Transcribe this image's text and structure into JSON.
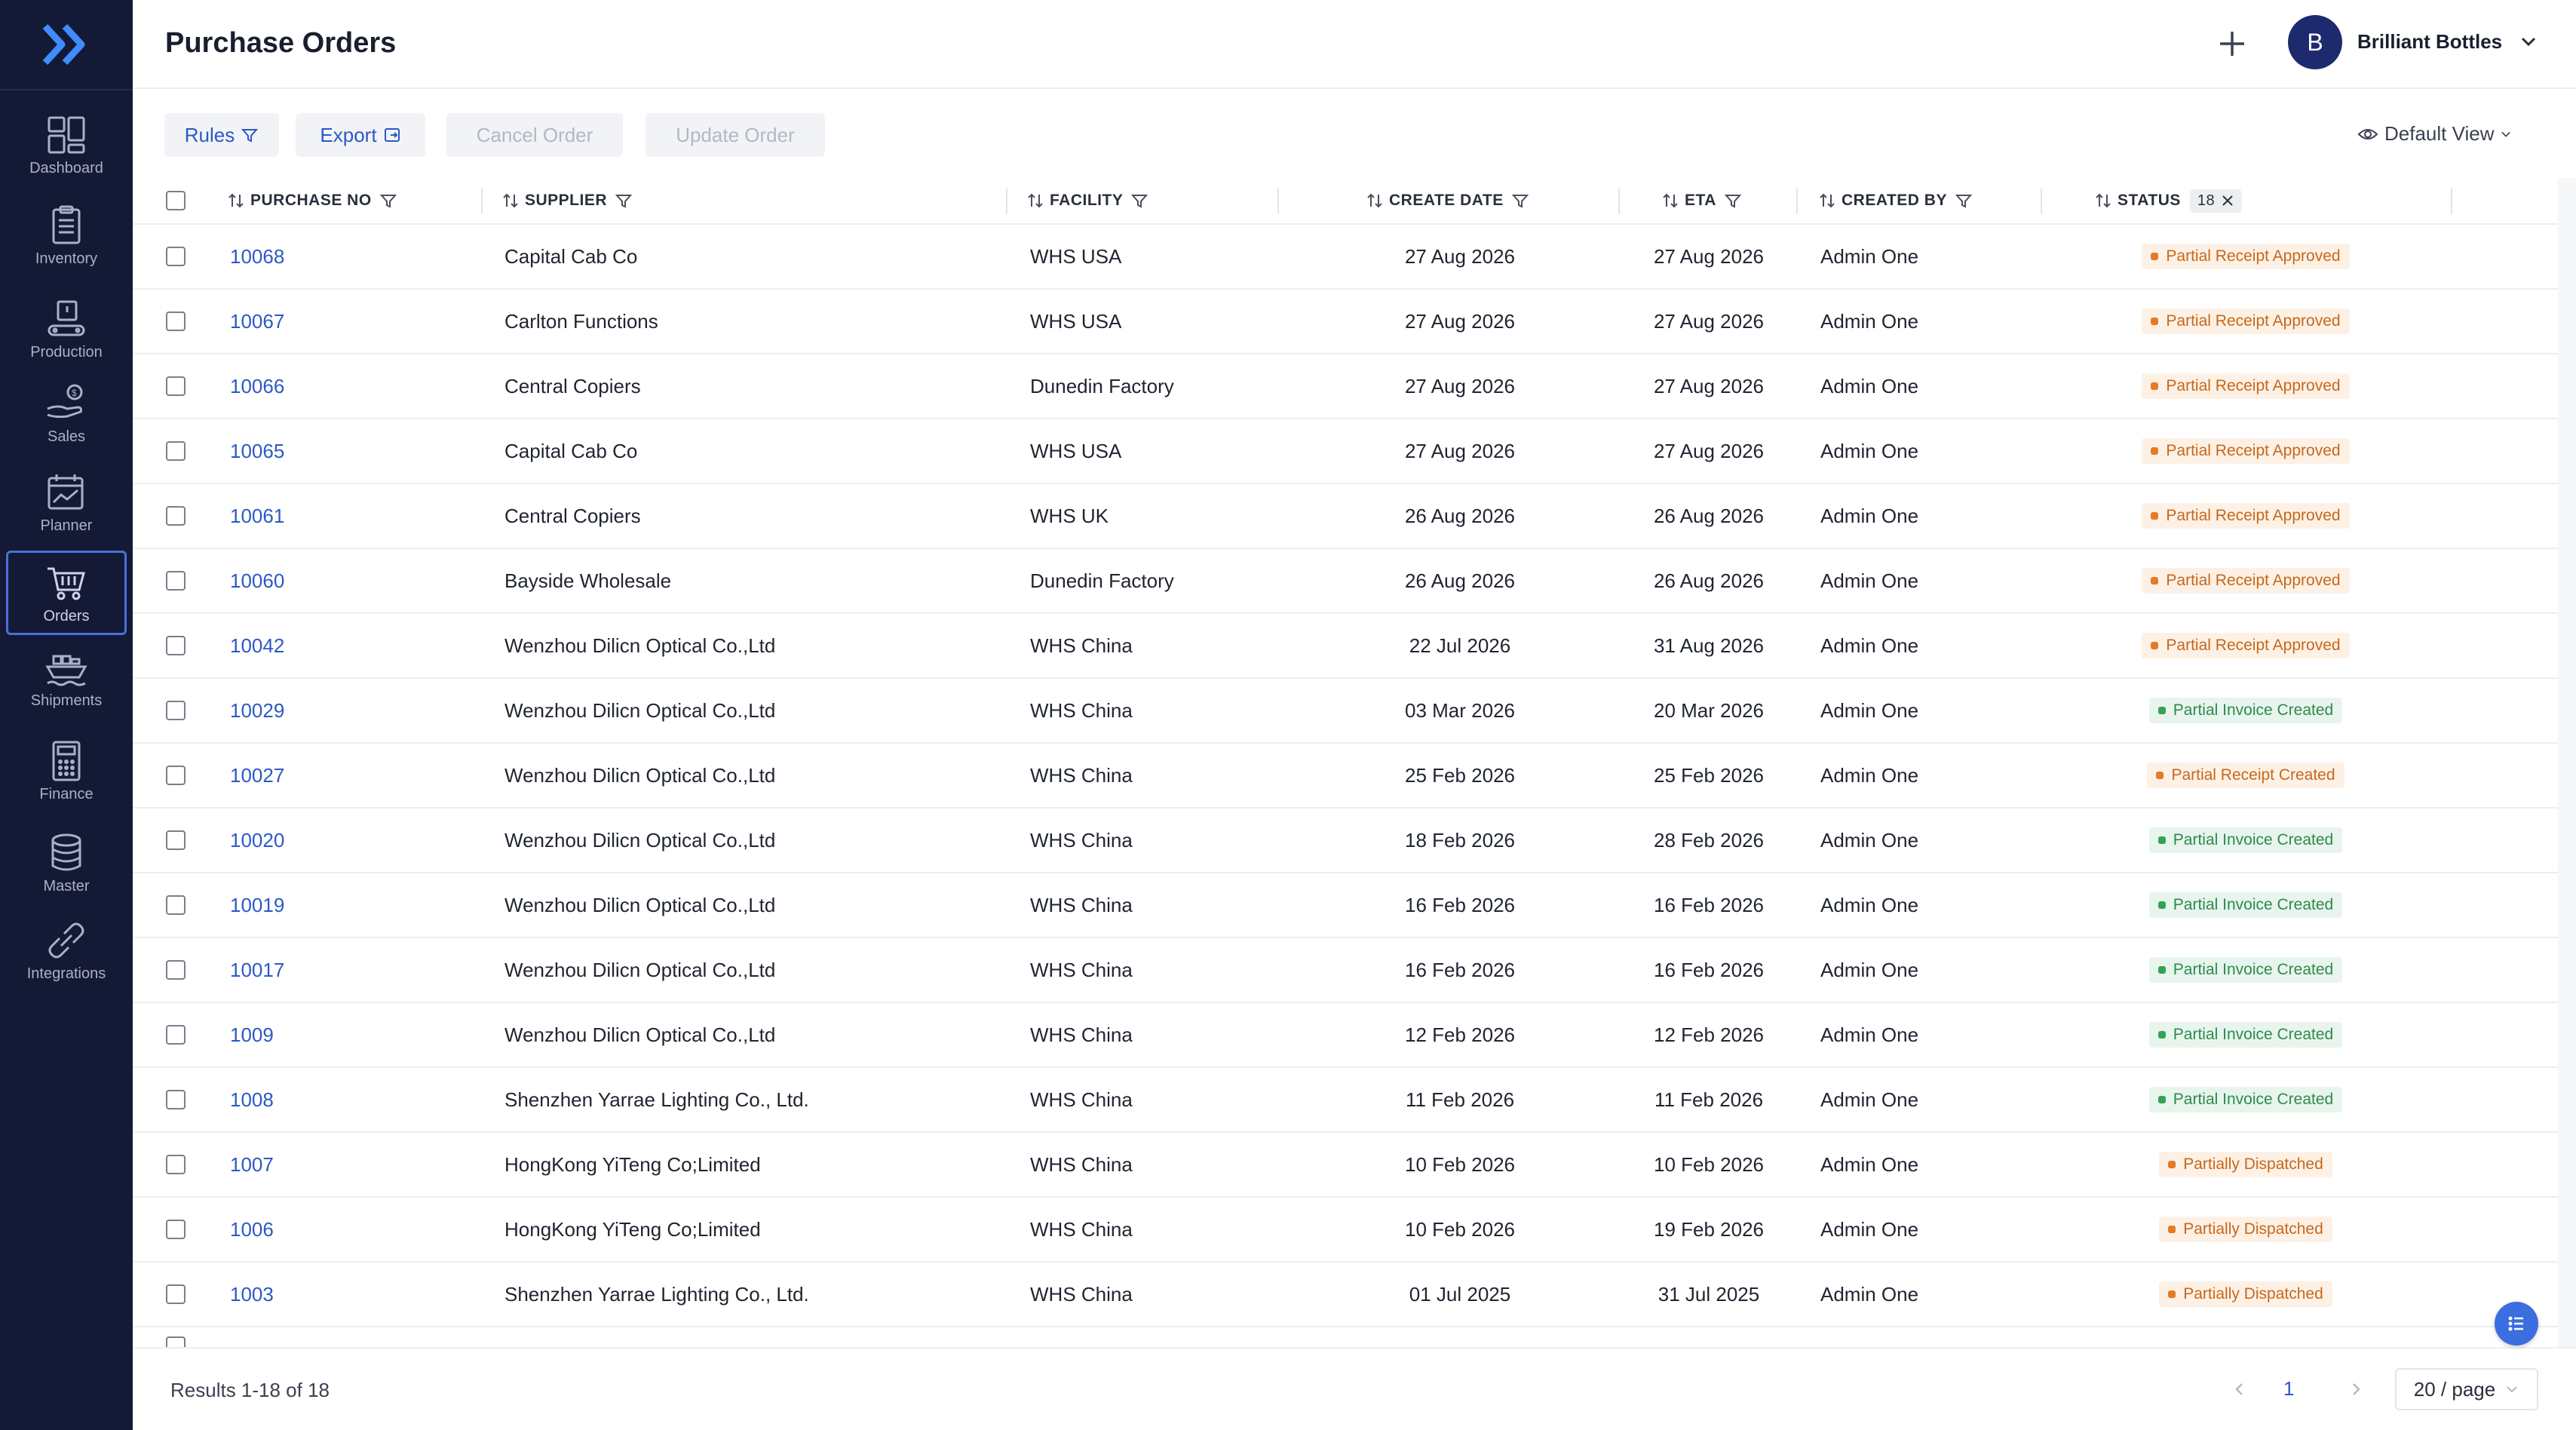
{
  "sidebar": {
    "items": [
      {
        "label": "Dashboard",
        "icon": "dashboard-icon"
      },
      {
        "label": "Inventory",
        "icon": "clipboard-icon"
      },
      {
        "label": "Production",
        "icon": "conveyor-icon"
      },
      {
        "label": "Sales",
        "icon": "sales-hand-icon"
      },
      {
        "label": "Planner",
        "icon": "calendar-chart-icon"
      },
      {
        "label": "Orders",
        "icon": "cart-icon",
        "active": true
      },
      {
        "label": "Shipments",
        "icon": "ship-icon"
      },
      {
        "label": "Finance",
        "icon": "calculator-icon"
      },
      {
        "label": "Master",
        "icon": "database-icon"
      },
      {
        "label": "Integrations",
        "icon": "link-icon"
      }
    ]
  },
  "header": {
    "title": "Purchase Orders",
    "avatar_initial": "B",
    "org_name": "Brilliant Bottles"
  },
  "toolbar": {
    "rules_label": "Rules",
    "export_label": "Export",
    "cancel_label": "Cancel Order",
    "update_label": "Update Order",
    "view_label": "Default View"
  },
  "table": {
    "columns": {
      "purchase_no": "PURCHASE NO",
      "supplier": "SUPPLIER",
      "facility": "FACILITY",
      "create_date": "CREATE DATE",
      "eta": "ETA",
      "created_by": "CREATED BY",
      "status": "STATUS",
      "status_count": "18"
    },
    "rows": [
      {
        "po": "10068",
        "supplier": "Capital Cab Co",
        "facility": "WHS USA",
        "create": "27 Aug 2026",
        "eta": "27 Aug 2026",
        "by": "Admin One",
        "status": "Partial Receipt Approved",
        "tone": "orange"
      },
      {
        "po": "10067",
        "supplier": "Carlton Functions",
        "facility": "WHS USA",
        "create": "27 Aug 2026",
        "eta": "27 Aug 2026",
        "by": "Admin One",
        "status": "Partial Receipt Approved",
        "tone": "orange"
      },
      {
        "po": "10066",
        "supplier": "Central Copiers",
        "facility": "Dunedin Factory",
        "create": "27 Aug 2026",
        "eta": "27 Aug 2026",
        "by": "Admin One",
        "status": "Partial Receipt Approved",
        "tone": "orange"
      },
      {
        "po": "10065",
        "supplier": "Capital Cab Co",
        "facility": "WHS USA",
        "create": "27 Aug 2026",
        "eta": "27 Aug 2026",
        "by": "Admin One",
        "status": "Partial Receipt Approved",
        "tone": "orange"
      },
      {
        "po": "10061",
        "supplier": "Central Copiers",
        "facility": "WHS UK",
        "create": "26 Aug 2026",
        "eta": "26 Aug 2026",
        "by": "Admin One",
        "status": "Partial Receipt Approved",
        "tone": "orange"
      },
      {
        "po": "10060",
        "supplier": "Bayside Wholesale",
        "facility": "Dunedin Factory",
        "create": "26 Aug 2026",
        "eta": "26 Aug 2026",
        "by": "Admin One",
        "status": "Partial Receipt Approved",
        "tone": "orange"
      },
      {
        "po": "10042",
        "supplier": "Wenzhou Dilicn Optical Co.,Ltd",
        "facility": "WHS China",
        "create": "22 Jul 2026",
        "eta": "31 Aug 2026",
        "by": "Admin One",
        "status": "Partial Receipt Approved",
        "tone": "orange"
      },
      {
        "po": "10029",
        "supplier": "Wenzhou Dilicn Optical Co.,Ltd",
        "facility": "WHS China",
        "create": "03 Mar 2026",
        "eta": "20 Mar 2026",
        "by": "Admin One",
        "status": "Partial Invoice Created",
        "tone": "green"
      },
      {
        "po": "10027",
        "supplier": "Wenzhou Dilicn Optical Co.,Ltd",
        "facility": "WHS China",
        "create": "25 Feb 2026",
        "eta": "25 Feb 2026",
        "by": "Admin One",
        "status": "Partial Receipt Created",
        "tone": "orange"
      },
      {
        "po": "10020",
        "supplier": "Wenzhou Dilicn Optical Co.,Ltd",
        "facility": "WHS China",
        "create": "18 Feb 2026",
        "eta": "28 Feb 2026",
        "by": "Admin One",
        "status": "Partial Invoice Created",
        "tone": "green"
      },
      {
        "po": "10019",
        "supplier": "Wenzhou Dilicn Optical Co.,Ltd",
        "facility": "WHS China",
        "create": "16 Feb 2026",
        "eta": "16 Feb 2026",
        "by": "Admin One",
        "status": "Partial Invoice Created",
        "tone": "green"
      },
      {
        "po": "10017",
        "supplier": "Wenzhou Dilicn Optical Co.,Ltd",
        "facility": "WHS China",
        "create": "16 Feb 2026",
        "eta": "16 Feb 2026",
        "by": "Admin One",
        "status": "Partial Invoice Created",
        "tone": "green"
      },
      {
        "po": "1009",
        "supplier": "Wenzhou Dilicn Optical Co.,Ltd",
        "facility": "WHS China",
        "create": "12 Feb 2026",
        "eta": "12 Feb 2026",
        "by": "Admin One",
        "status": "Partial Invoice Created",
        "tone": "green"
      },
      {
        "po": "1008",
        "supplier": "Shenzhen Yarrae Lighting Co., Ltd.",
        "facility": "WHS China",
        "create": "11 Feb 2026",
        "eta": "11 Feb 2026",
        "by": "Admin One",
        "status": "Partial Invoice Created",
        "tone": "green"
      },
      {
        "po": "1007",
        "supplier": "HongKong YiTeng Co;Limited",
        "facility": "WHS China",
        "create": "10 Feb 2026",
        "eta": "10 Feb 2026",
        "by": "Admin One",
        "status": "Partially Dispatched",
        "tone": "orange"
      },
      {
        "po": "1006",
        "supplier": "HongKong YiTeng Co;Limited",
        "facility": "WHS China",
        "create": "10 Feb 2026",
        "eta": "19 Feb 2026",
        "by": "Admin One",
        "status": "Partially Dispatched",
        "tone": "orange"
      },
      {
        "po": "1003",
        "supplier": "Shenzhen Yarrae Lighting Co., Ltd.",
        "facility": "WHS China",
        "create": "01 Jul 2025",
        "eta": "31 Jul 2025",
        "by": "Admin One",
        "status": "Partially Dispatched",
        "tone": "orange"
      }
    ]
  },
  "footer": {
    "results": "Results 1-18 of 18",
    "page": "1",
    "page_size": "20 / page"
  },
  "colors": {
    "sidebar_bg": "#141a36",
    "accent": "#2c58c7",
    "status_orange": "#e47b24",
    "status_green": "#34a25a"
  }
}
